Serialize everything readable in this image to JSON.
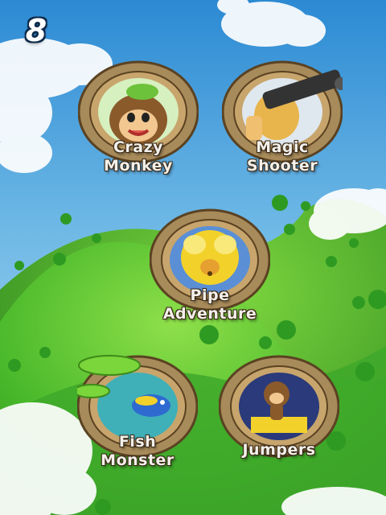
{
  "level_badge": {
    "value": "8"
  },
  "games": [
    {
      "line1": "Crazy",
      "line2": "Monkey",
      "icon": "monkey-face-icon"
    },
    {
      "line1": "Magic",
      "line2": "Shooter",
      "icon": "gun-monkey-icon"
    },
    {
      "line1": "Pipe",
      "line2": "Adventure",
      "icon": "pipe-mouse-icon"
    },
    {
      "line1": "Fish",
      "line2": "Monster",
      "icon": "fish-icon"
    },
    {
      "line1": "Jumpers",
      "line2": "",
      "icon": "jumping-monkey-icon"
    }
  ],
  "colors": {
    "sky_top": "#2f8fd6",
    "sky_bottom": "#9fd2f0",
    "hill": "#4fbf2a",
    "ring_wood": "#a88b5a",
    "ring_dark": "#5a4222"
  }
}
